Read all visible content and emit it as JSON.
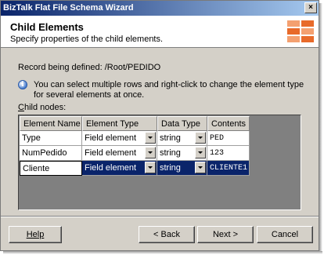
{
  "window": {
    "title": "BizTalk Flat File Schema Wizard",
    "close_glyph": "×"
  },
  "header": {
    "title": "Child Elements",
    "subtitle": "Specify properties of the child elements.",
    "logo_icon": "biztalk-logo-icon"
  },
  "record": {
    "label": "Record being defined:",
    "path": "/Root/PEDIDO"
  },
  "info": {
    "icon": "info-icon",
    "text": "You can select multiple rows and right-click to change the element type for several elements at once."
  },
  "child_nodes_label": "Child nodes:",
  "grid": {
    "columns": [
      "Element Name",
      "Element Type",
      "Data Type",
      "Contents"
    ],
    "rows": [
      {
        "name": "Type",
        "element_type": "Field element",
        "data_type": "string",
        "contents": "PED",
        "selected": false
      },
      {
        "name": "NumPedido",
        "element_type": "Field element",
        "data_type": "string",
        "contents": "123",
        "selected": false
      },
      {
        "name": "Cliente",
        "element_type": "Field element",
        "data_type": "string",
        "contents": "CLIENTE1",
        "selected": true
      }
    ]
  },
  "buttons": {
    "help": "Help",
    "back": "< Back",
    "next": "Next >",
    "cancel": "Cancel"
  }
}
